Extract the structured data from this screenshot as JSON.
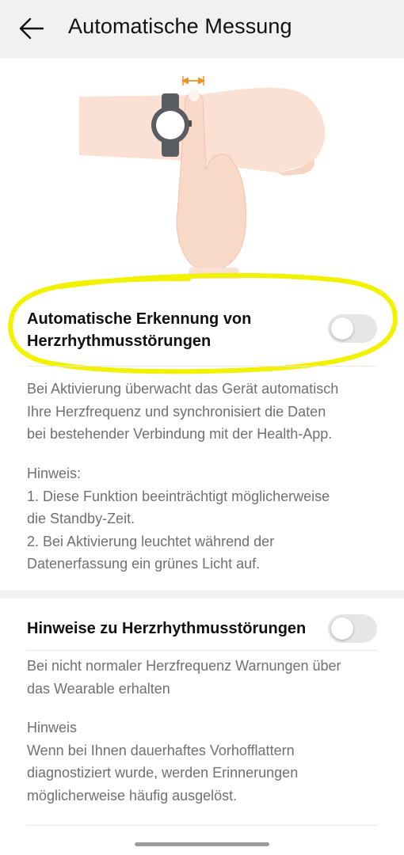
{
  "header": {
    "back_icon": "arrow-left-icon",
    "title": "Automatische Messung"
  },
  "illustration": {
    "description_icon": "wrist-measurement-illustration",
    "colors": {
      "skin": "#fbe1d3",
      "watch": "#595c60",
      "accent": "#f08a24"
    }
  },
  "section1": {
    "toggle_label": "Automatische Erkennung von Herzrhythmusstörungen",
    "toggle_label_lines": [
      "Automatische Erkennung von",
      "Herzrhythmusstörungen"
    ],
    "toggle_on": false,
    "description_lines": [
      "Bei Aktivierung überwacht das Gerät automatisch",
      "Ihre Herzfrequenz und synchronisiert die Daten",
      "bei bestehender Verbindung mit der Health-App."
    ],
    "note_lines": [
      "Hinweis:",
      "1. Diese Funktion beeinträchtigt möglicherweise",
      "die Standby-Zeit.",
      "2. Bei Aktivierung leuchtet während der",
      "Datenerfassung ein grünes Licht auf."
    ]
  },
  "section2": {
    "toggle_label": "Hinweise zu Herzrhythmusstörungen",
    "toggle_on": false,
    "description_lines": [
      "Bei nicht normaler Herzfrequenz Warnungen über",
      "das Wearable erhalten"
    ],
    "note_lines": [
      "Hinweis",
      "Wenn bei Ihnen dauerhaftes Vorhofflattern",
      "diagnostiziert wurde, werden Erinnerungen",
      "möglicherweise häufig ausgelöst."
    ]
  },
  "annotation": {
    "highlight_color": "#f2f200"
  }
}
